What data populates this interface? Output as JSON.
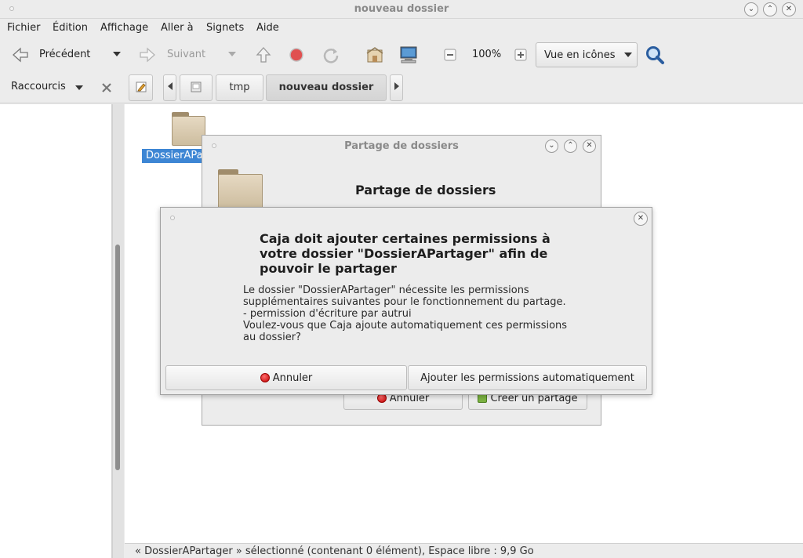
{
  "window": {
    "title": "nouveau dossier"
  },
  "menu": [
    "Fichier",
    "Édition",
    "Affichage",
    "Aller à",
    "Signets",
    "Aide"
  ],
  "toolbar": {
    "back_label": "Précédent",
    "forward_label": "Suivant",
    "zoom_level": "100%",
    "view_mode": "Vue en icônes"
  },
  "sidebar": {
    "selector_label": "Raccourcis"
  },
  "location": {
    "crumbs": [
      "tmp",
      "nouveau dossier"
    ]
  },
  "main": {
    "folder_label": "DossierAPa"
  },
  "status": {
    "text": "« DossierAPartager » sélectionné (contenant 0 élément), Espace libre : 9,9 Go"
  },
  "share_dialog": {
    "title": "Partage de dossiers",
    "heading": "Partage de dossiers",
    "cancel_label": "Annuler",
    "create_label": "Créer un partage"
  },
  "perm_dialog": {
    "heading": "Caja doit ajouter certaines permissions à votre dossier \"DossierAPartager\" afin de pouvoir le partager",
    "body_lines": [
      "Le dossier \"DossierAPartager\" nécessite les permissions",
      "supplémentaires suivantes pour le fonctionnement du partage.",
      "- permission d'écriture par autrui",
      "Voulez-vous que Caja ajoute automatiquement ces permissions",
      "au dossier?"
    ],
    "cancel_label": "Annuler",
    "confirm_label": "Ajouter les permissions automatiquement"
  }
}
